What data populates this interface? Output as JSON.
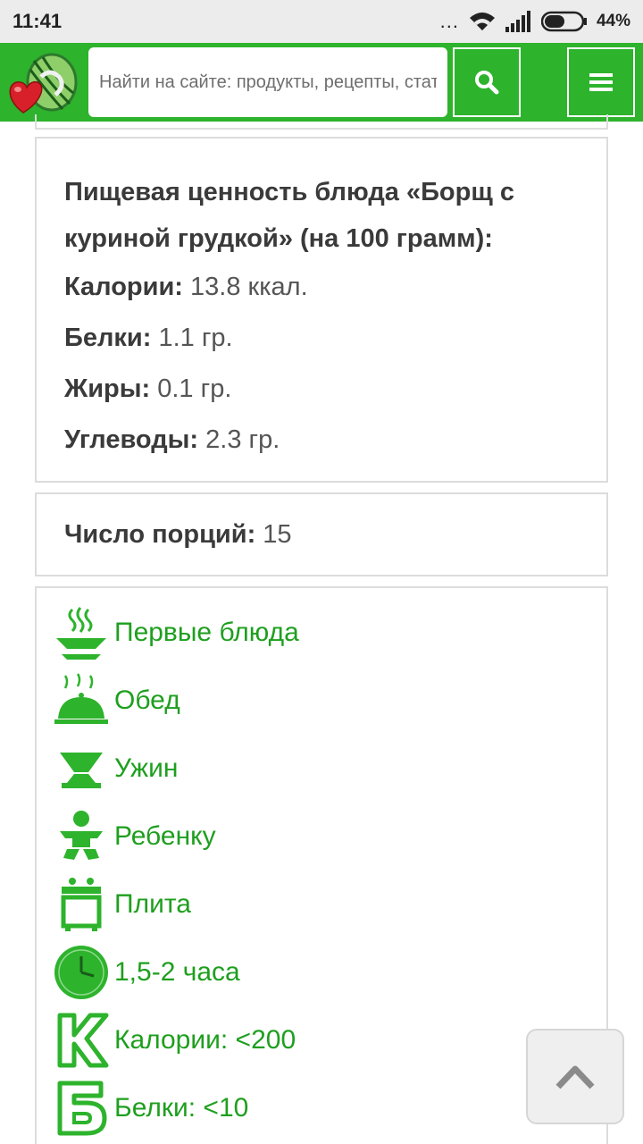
{
  "status_bar": {
    "time": "11:41",
    "dots": "...",
    "battery": "44%"
  },
  "header": {
    "search_placeholder": "Найти на сайте: продукты, рецепты, статьи",
    "colors": {
      "brand_green": "#2db32c",
      "link_green": "#1e9f1e"
    },
    "icons": {
      "logo": "watermelon-heart-logo",
      "search": "search-icon",
      "menu": "hamburger-menu-icon"
    }
  },
  "nutrition": {
    "title": "Пищевая ценность блюда «Борщ с куриной грудкой» (на 100 грамм):",
    "rows": [
      {
        "label": "Калории:",
        "value": "13.8 ккал."
      },
      {
        "label": "Белки:",
        "value": "1.1 гр."
      },
      {
        "label": "Жиры:",
        "value": "0.1 гр."
      },
      {
        "label": "Углеводы:",
        "value": "2.3 гр."
      }
    ]
  },
  "portions": {
    "label": "Число порций:",
    "value": "15"
  },
  "tags": [
    {
      "icon": "steaming-bowl-icon",
      "label": "Первые блюда"
    },
    {
      "icon": "cloche-dish-icon",
      "label": "Обед"
    },
    {
      "icon": "dinner-bowl-icon",
      "label": "Ужин"
    },
    {
      "icon": "child-icon",
      "label": "Ребенку"
    },
    {
      "icon": "stove-icon",
      "label": "Плита"
    },
    {
      "icon": "clock-icon",
      "label": "1,5-2 часа"
    },
    {
      "icon": "letter-k-icon",
      "label": "Калории: <200"
    },
    {
      "icon": "letter-b-icon",
      "label": "Белки: <10"
    }
  ]
}
